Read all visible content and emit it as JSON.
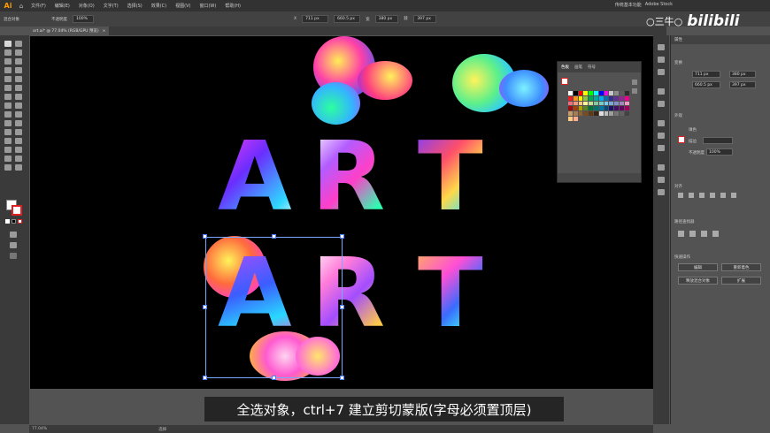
{
  "app": {
    "logo": "Ai",
    "home_icon": "⌂"
  },
  "menu": [
    "文件(F)",
    "编辑(E)",
    "对象(O)",
    "文字(T)",
    "选择(S)",
    "效果(C)",
    "视图(V)",
    "窗口(W)",
    "帮助(H)"
  ],
  "menu_right": [
    "传统基本功能",
    "Adobe Stock"
  ],
  "options": {
    "selection_label": "混合对象",
    "opacity_label": "不透明度",
    "opacity_value": "100%",
    "x_label": "X",
    "x_value": "711 px",
    "y_value": "660.5 px",
    "w_label": "宽",
    "w_value": "380 px",
    "h_label": "高",
    "h_value": "397 px"
  },
  "document": {
    "tab_title": "art.ai* @ 77.04% (RGB/GPU 预览)",
    "close_icon": "×"
  },
  "artwork": {
    "row1": [
      "A",
      "R",
      "T"
    ],
    "row2": [
      "A",
      "R",
      "T"
    ]
  },
  "swatches_panel": {
    "tabs": [
      "色板",
      "画笔",
      "符号"
    ],
    "colors": [
      "#ffffff",
      "#000000",
      "#ff0000",
      "#ffff00",
      "#00ff00",
      "#00ffff",
      "#0000ff",
      "#ff00ff",
      "#c8c8c8",
      "#8c8c8c",
      "#5a5a5a",
      "#2d2d2d",
      "#ed1c24",
      "#f7941d",
      "#fff200",
      "#8dc63f",
      "#00a651",
      "#00a99d",
      "#00aeef",
      "#0072bc",
      "#2e3192",
      "#662d91",
      "#92278f",
      "#ec008c",
      "#f26d7d",
      "#f69679",
      "#fdc689",
      "#fff799",
      "#c4df9b",
      "#82ca9c",
      "#7accc8",
      "#6dcff6",
      "#7da7d9",
      "#8393ca",
      "#a187be",
      "#f49ac1",
      "#9e0b0f",
      "#a0410d",
      "#aba000",
      "#598527",
      "#007236",
      "#00746b",
      "#0076a3",
      "#004a80",
      "#1b1464",
      "#440e62",
      "#630460",
      "#9e005d",
      "#c69c6d",
      "#a67c52",
      "#8c6239",
      "#754c24",
      "#603913",
      "#3c2415",
      "#e0e0e0",
      "#bdbdbd",
      "#9e9e9e",
      "#757575",
      "#616161",
      "#424242",
      "#ffcc80",
      "#ffab91"
    ]
  },
  "properties": {
    "title": "属性",
    "section_transform": "变换",
    "x_value": "711 px",
    "y_value": "660.5 px",
    "w_value": "380 px",
    "h_value": "397 px",
    "section_appearance": "外观",
    "fill_label": "填色",
    "stroke_label": "描边",
    "opacity_label": "不透明度",
    "opacity_value": "100%",
    "section_align": "对齐",
    "section_pathfinder": "路径查找器",
    "section_quick": "快速操作",
    "btn_edit": "编辑",
    "btn_recolor": "重新着色",
    "btn_release": "释放混合对象",
    "btn_expand": "扩展"
  },
  "caption": "全选对象，ctrl+7    建立剪切蒙版(字母必须置顶层)",
  "status": {
    "zoom": "77.04%",
    "selection": "选择"
  },
  "watermark": {
    "user": "○三牛○",
    "brand": "bilibili"
  }
}
